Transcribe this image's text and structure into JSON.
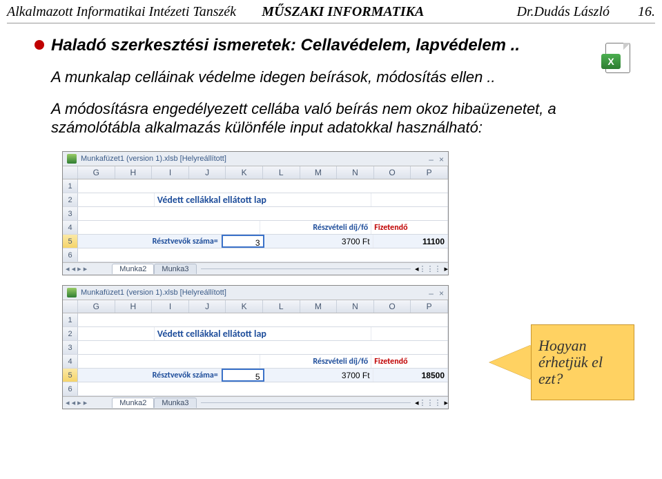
{
  "header": {
    "left": "Alkalmazott Informatikai Intézeti Tanszék",
    "center": "MŰSZAKI INFORMATIKA",
    "author": "Dr.Dudás László",
    "pageno": "16."
  },
  "title": "Haladó szerkesztési ismeretek: Cellavédelem, lapvédelem ..",
  "para1": "A munkalap celláinak védelme idegen beírások, módosítás ellen ..",
  "para2": "A módosításra engedélyezett cellába való beírás nem okoz hibaüzenetet, a számolótábla alkalmazás különféle input adatokkal használható:",
  "excel_icon_label": "X",
  "screenshot": {
    "window_title": "Munkafüzet1 (version 1).xlsb [Helyreállított]",
    "columns": [
      "G",
      "H",
      "I",
      "J",
      "K",
      "L",
      "M",
      "N",
      "O",
      "P"
    ],
    "sheet_title": "Védett cellákkal ellátott lap",
    "label_resztvevok": "Résztvevők száma=",
    "label_reszvdij": "Részvételi díj/fő",
    "label_fizetendo": "Fizetendő",
    "dij_value": "3700 Ft",
    "tabs": {
      "t2": "Munka2",
      "t3": "Munka3"
    },
    "nav_glyphs": "◂ ◂ ▸ ▸",
    "ctrl_min": "–",
    "ctrl_close": "×",
    "grip": "⋮⋮⋮"
  },
  "shot1": {
    "input_value": "3",
    "fizetendo_value": "11100"
  },
  "shot2": {
    "input_value": "5",
    "fizetendo_value": "18500"
  },
  "callout": "Hogyan érhetjük el ezt?"
}
